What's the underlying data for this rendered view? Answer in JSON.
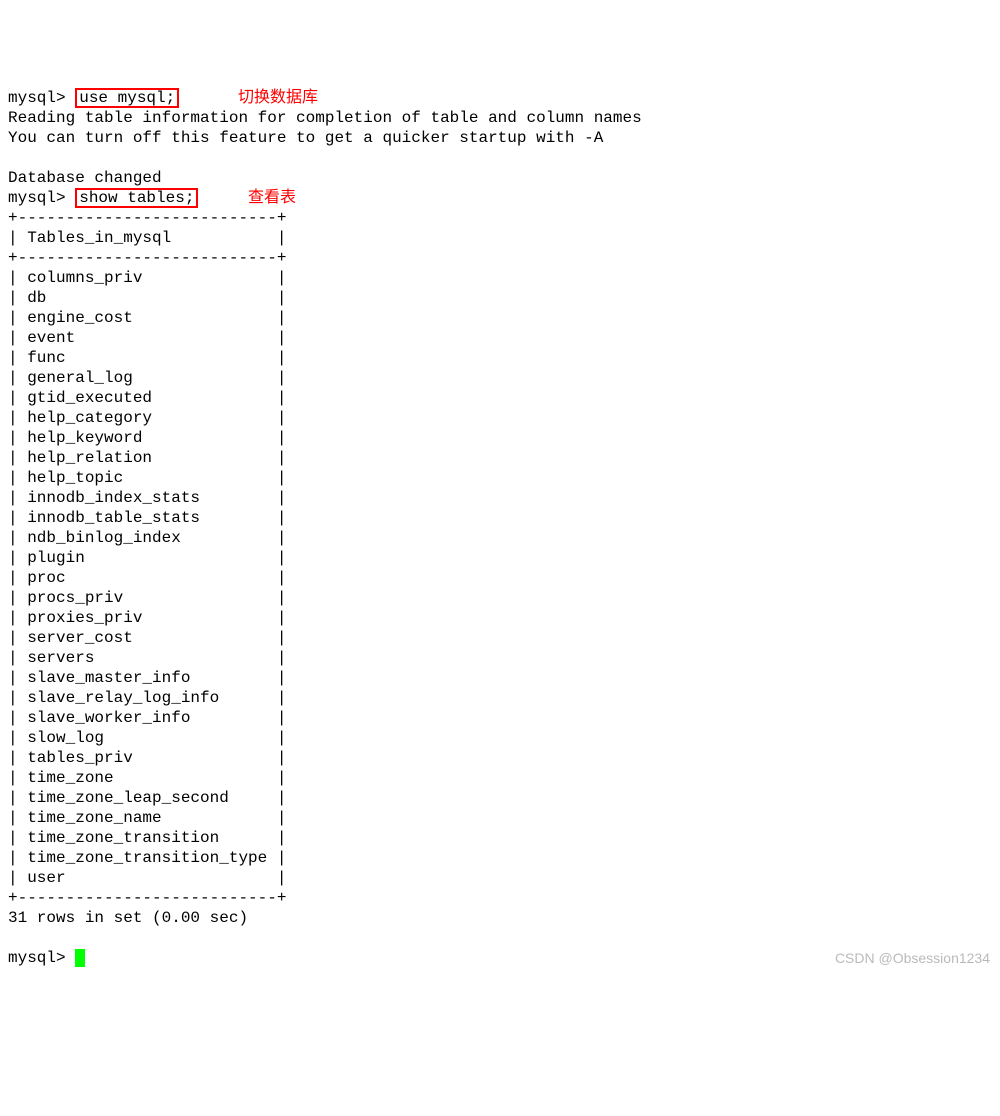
{
  "prompt": "mysql>",
  "cmd1": "use mysql;",
  "anno1": "切换数据库",
  "response1_line1": "Reading table information for completion of table and column names",
  "response1_line2": "You can turn off this feature to get a quicker startup with -A",
  "db_changed": "Database changed",
  "cmd2": "show tables;",
  "anno2": "查看表",
  "table_border": "+---------------------------+",
  "table_header": "| Tables_in_mysql           |",
  "table_rows": [
    "columns_priv",
    "db",
    "engine_cost",
    "event",
    "func",
    "general_log",
    "gtid_executed",
    "help_category",
    "help_keyword",
    "help_relation",
    "help_topic",
    "innodb_index_stats",
    "innodb_table_stats",
    "ndb_binlog_index",
    "plugin",
    "proc",
    "procs_priv",
    "proxies_priv",
    "server_cost",
    "servers",
    "slave_master_info",
    "slave_relay_log_info",
    "slave_worker_info",
    "slow_log",
    "tables_priv",
    "time_zone",
    "time_zone_leap_second",
    "time_zone_name",
    "time_zone_transition",
    "time_zone_transition_type",
    "user"
  ],
  "result_summary": "31 rows in set (0.00 sec)",
  "watermark": "CSDN @Obsession1234"
}
